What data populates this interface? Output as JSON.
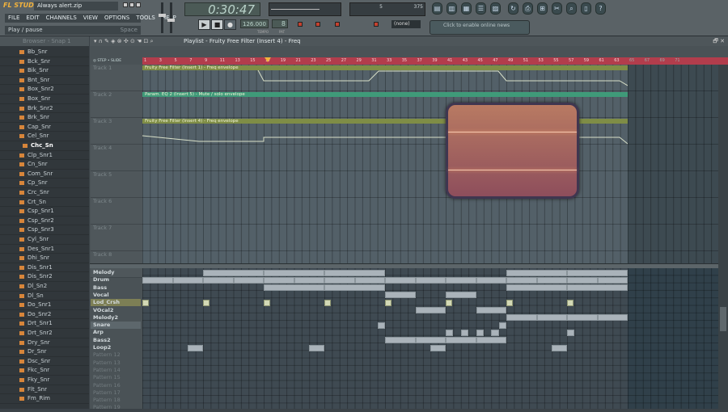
{
  "app": {
    "logo": "FL STUDIO",
    "title": "Always alert.zip"
  },
  "menu": [
    "FILE",
    "EDIT",
    "CHANNELS",
    "VIEW",
    "OPTIONS",
    "TOOLS",
    "HELP"
  ],
  "hint": {
    "text": "Play / pause",
    "shortcut": "Space"
  },
  "transport": {
    "time": "0:30:47",
    "tempo": "126.000",
    "tempo_label": "TEMPO",
    "pattern": "8",
    "pattern_label": "PAT",
    "monitor_left": "5",
    "monitor_right": "375",
    "preset": "(none)",
    "news": "Click to enable online news"
  },
  "browser": {
    "title": "Browser - Snap 1",
    "items": [
      "Bb_Snr",
      "Bck_Snr",
      "Bik_Snr",
      "Bnt_Snr",
      "Box_Snr2",
      "Box_Snr",
      "Brk_Snr2",
      "Brk_Snr",
      "Cap_Snr",
      "Cel_Snr",
      "Chc_Sn",
      "Clp_Snr1",
      "Cn_Snr",
      "Com_Snr",
      "Cp_Snr",
      "Crc_Snr",
      "Crt_Sn",
      "Csp_Snr1",
      "Csp_Snr2",
      "Csp_Snr3",
      "Cyl_Snr",
      "Des_Snr1",
      "Dhi_Snr",
      "Dis_Snr1",
      "Dis_Snr2",
      "Dl_Sn2",
      "Dl_Sn",
      "Do_Snr1",
      "Do_Snr2",
      "Drt_Snr1",
      "Drt_Snr2",
      "Dry_Snr",
      "Dr_Snr",
      "Dsc_Snr",
      "Fkc_Snr",
      "Fky_Snr",
      "Flt_Snr",
      "Fm_Rim"
    ],
    "selected": "Chc_Sn"
  },
  "playlist": {
    "title": "Playlist - Fruity Free Filter (Insert 4) - Freq",
    "step_label": "STEP",
    "slide_label": "SLIDE",
    "ruler_start": 1,
    "ruler_end": 71,
    "ruler_step": 2,
    "tracks": [
      "Track 1",
      "Track 2",
      "Track 3",
      "Track 4",
      "Track 5",
      "Track 6",
      "Track 7",
      "Track 8"
    ],
    "clips": [
      {
        "track": 0,
        "label": "Fruity Free Filter (Insert 1) - Freq envelope",
        "color": "#7f8d46"
      },
      {
        "track": 1,
        "label": "Param. EQ 2 (Insert 5) - Mute / solo envelope",
        "color": "#3f9a79"
      },
      {
        "track": 2,
        "label": "Fruity Free Filter (Insert 4) - Freq envelope",
        "color": "#7f8d46"
      }
    ],
    "patterns": [
      {
        "name": "Melody",
        "blocks": [
          [
            2,
            2
          ],
          [
            4,
            2
          ],
          [
            6,
            2
          ],
          [
            12,
            2
          ],
          [
            14,
            2
          ]
        ]
      },
      {
        "name": "Drum",
        "blocks": [
          [
            0,
            1
          ],
          [
            1,
            1
          ],
          [
            2,
            1
          ],
          [
            3,
            1
          ],
          [
            4,
            1
          ],
          [
            5,
            1
          ],
          [
            6,
            1
          ],
          [
            7,
            1
          ],
          [
            8,
            1
          ],
          [
            9,
            1
          ],
          [
            10,
            1
          ],
          [
            11,
            1
          ],
          [
            12,
            1
          ],
          [
            13,
            1
          ],
          [
            14,
            1
          ],
          [
            15,
            1
          ]
        ]
      },
      {
        "name": "Bass",
        "blocks": [
          [
            4,
            2
          ],
          [
            6,
            2
          ],
          [
            12,
            2
          ],
          [
            14,
            2
          ]
        ]
      },
      {
        "name": "Vocal",
        "blocks": [
          [
            8,
            1
          ],
          [
            10,
            1
          ]
        ]
      },
      {
        "name": "Lod_Crsh",
        "selected": true,
        "blocks": [
          [
            0,
            0.22
          ],
          [
            2,
            0.22
          ],
          [
            4,
            0.22
          ],
          [
            6,
            0.22
          ],
          [
            8,
            0.22
          ],
          [
            10,
            0.22
          ],
          [
            12,
            0.22
          ],
          [
            14,
            0.22
          ]
        ]
      },
      {
        "name": "VOcal2",
        "blocks": [
          [
            9,
            1
          ],
          [
            11,
            1
          ]
        ]
      },
      {
        "name": "Melody2",
        "blocks": [
          [
            12,
            1
          ],
          [
            13,
            1
          ],
          [
            14,
            1
          ],
          [
            15,
            1
          ]
        ]
      },
      {
        "name": "Snare",
        "blocks": [
          [
            7.75,
            0.25
          ],
          [
            11.75,
            0.25
          ]
        ]
      },
      {
        "name": "Arp",
        "blocks": [
          [
            10,
            0.25
          ],
          [
            10.5,
            0.25
          ],
          [
            11,
            0.25
          ],
          [
            11.5,
            0.25
          ],
          [
            14,
            0.25
          ]
        ]
      },
      {
        "name": "Bass2",
        "blocks": [
          [
            8,
            1
          ],
          [
            9,
            1
          ],
          [
            10,
            1
          ],
          [
            11,
            1
          ]
        ]
      },
      {
        "name": "Loop2",
        "blocks": [
          [
            1.5,
            0.5
          ],
          [
            5.5,
            0.5
          ],
          [
            9.5,
            0.5
          ],
          [
            13.5,
            0.5
          ]
        ]
      },
      {
        "name": "Pattern 12",
        "blocks": []
      },
      {
        "name": "Pattern 13",
        "blocks": []
      },
      {
        "name": "Pattern 14",
        "blocks": []
      },
      {
        "name": "Pattern 15",
        "blocks": []
      },
      {
        "name": "Pattern 16",
        "blocks": []
      },
      {
        "name": "Pattern 17",
        "blocks": []
      },
      {
        "name": "Pattern 18",
        "blocks": []
      },
      {
        "name": "Pattern 19",
        "blocks": []
      }
    ]
  },
  "colors": {
    "ruler": "#b23d4c",
    "accent": "#f3b33c",
    "widget": "#b06a5c"
  }
}
